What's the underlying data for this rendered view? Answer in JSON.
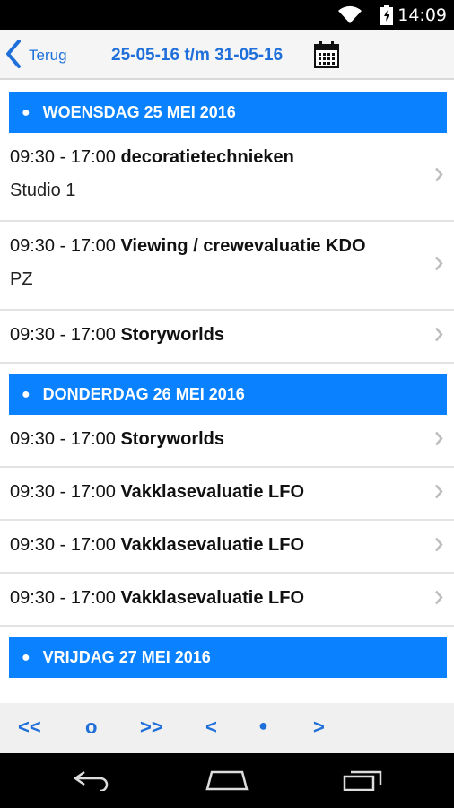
{
  "statusbar": {
    "time": "14:09"
  },
  "header": {
    "back_label": "Terug",
    "range": "25-05-16 t/m 31-05-16"
  },
  "days": [
    {
      "title": "WOENSDAG 25 MEI 2016",
      "items": [
        {
          "time": "09:30 - 17:00",
          "title": "decoratietechnieken",
          "sub": "Studio 1"
        },
        {
          "time": "09:30 - 17:00",
          "title": "Viewing / crewevaluatie KDO",
          "sub": "PZ"
        },
        {
          "time": "09:30 - 17:00",
          "title": "Storyworlds",
          "sub": ""
        }
      ]
    },
    {
      "title": "DONDERDAG 26 MEI 2016",
      "items": [
        {
          "time": "09:30 - 17:00",
          "title": "Storyworlds",
          "sub": ""
        },
        {
          "time": "09:30 - 17:00",
          "title": "Vakklasevaluatie LFO",
          "sub": ""
        },
        {
          "time": "09:30 - 17:00",
          "title": "Vakklasevaluatie LFO",
          "sub": ""
        },
        {
          "time": "09:30 - 17:00",
          "title": "Vakklasevaluatie LFO",
          "sub": ""
        }
      ]
    },
    {
      "title": "VRIJDAG 27 MEI 2016",
      "items": []
    }
  ],
  "pager": {
    "first": "<<",
    "current": "o",
    "last": ">>",
    "prev": "<",
    "dot": "●",
    "next": ">"
  },
  "colors": {
    "accent": "#1e6fd9",
    "day_header": "#0a82ff"
  }
}
